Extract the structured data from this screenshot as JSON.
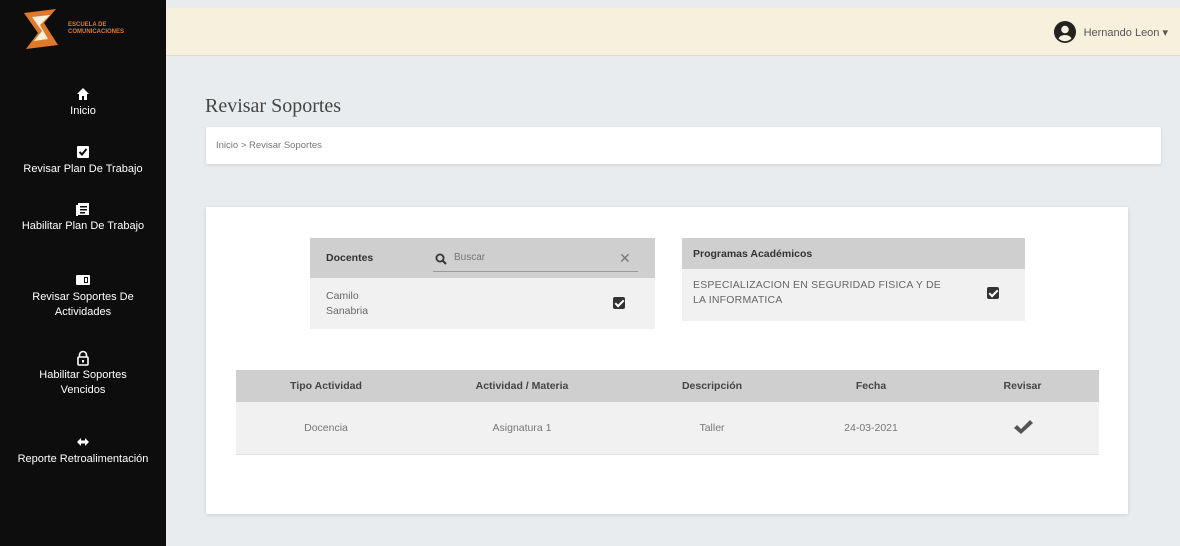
{
  "logo": {
    "text": "ESCUELA DE COMUNICACIONES"
  },
  "sidebar": {
    "items": [
      {
        "label": "Inicio",
        "icon": "home-icon"
      },
      {
        "label": "Revisar Plan De Trabajo",
        "icon": "checkbox-icon"
      },
      {
        "label": "Habilitar Plan De Trabajo",
        "icon": "document-icon"
      },
      {
        "label": "Revisar Soportes De Actividades",
        "icon": "folder-icon"
      },
      {
        "label": "Habilitar Soportes Vencidos",
        "icon": "lock-icon"
      },
      {
        "label": "Reporte Retroalimentación",
        "icon": "feedback-icon"
      }
    ]
  },
  "topbar": {
    "user_name": "Hernando Leon ▾"
  },
  "page": {
    "title": "Revisar Soportes",
    "breadcrumb": "Inicio > Revisar Soportes"
  },
  "docentes": {
    "title": "Docentes",
    "search_placeholder": "Buscar",
    "items": [
      {
        "name": "Camilo Sanabria",
        "checked": true
      }
    ]
  },
  "programas": {
    "title": "Programas Académicos",
    "items": [
      {
        "name": "ESPECIALIZACION EN SEGURIDAD FISICA Y DE LA INFORMATICA",
        "checked": true
      }
    ]
  },
  "table": {
    "headers": [
      "Tipo Actividad",
      "Actividad / Materia",
      "Descripción",
      "Fecha",
      "Revisar"
    ],
    "rows": [
      {
        "tipo": "Docencia",
        "actividad": "Asignatura 1",
        "descripcion": "Taller",
        "fecha": "24-03-2021"
      }
    ]
  },
  "colors": {
    "sidebar_bg": "#0d0d0d",
    "topbar_bg": "#f6f0dc",
    "page_bg": "#e9ecef",
    "header_gray": "#cfcfcf",
    "brand_orange": "#e07a2a"
  }
}
